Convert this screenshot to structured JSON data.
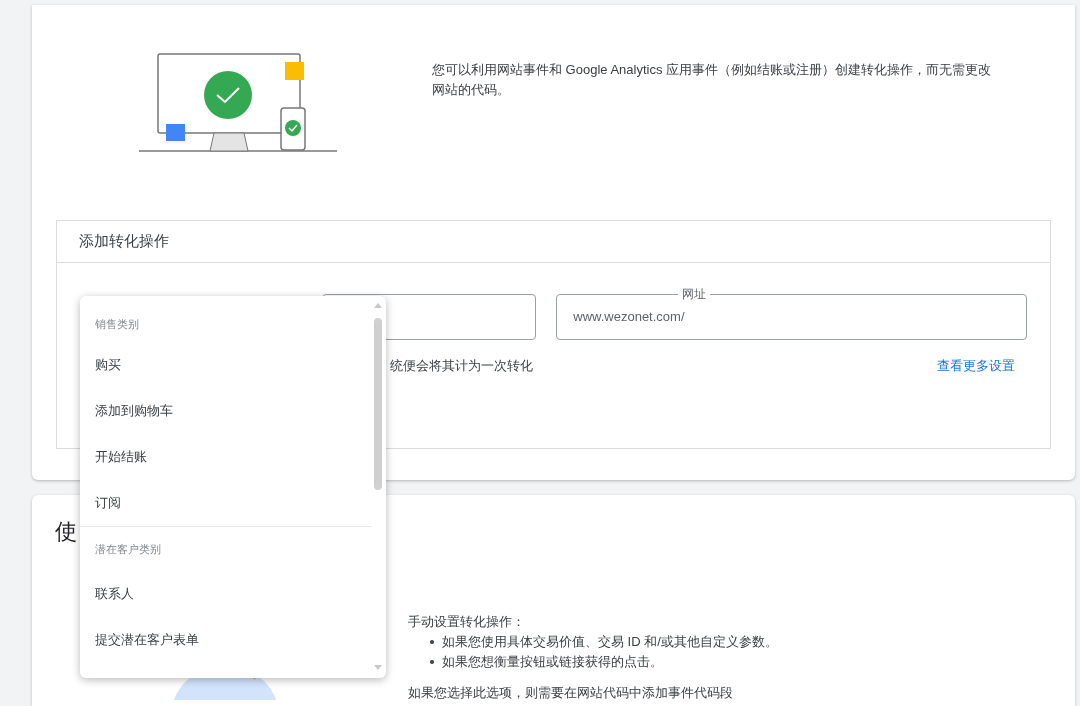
{
  "intro": {
    "text": "您可以利用网站事件和 Google Analytics 应用事件（例如结账或注册）创建转化操作，而无需更改网站的代码。"
  },
  "add_conversion": {
    "title": "添加转化操作",
    "fields": [
      {
        "focused": false
      },
      {
        "label": "网址",
        "value": "www.wezonet.com/",
        "focused": false
      }
    ],
    "hint": "统便会将其计为一次转化",
    "link": "查看更多设置"
  },
  "dropdown": {
    "groups": [
      {
        "heading": "销售类别",
        "items": [
          "购买",
          "添加到购物车",
          "开始结账",
          "订阅"
        ]
      },
      {
        "heading": "潜在客户类别",
        "items": [
          "联系人",
          "提交潜在客户表单"
        ]
      }
    ]
  },
  "section2": {
    "heading": "使",
    "intro": "手动设置转化操作：",
    "bullets": [
      "如果您使用具体交易价值、交易 ID 和/或其他自定义参数。",
      "如果您想衡量按钮或链接获得的点击。"
    ],
    "note": "如果您选择此选项，则需要在网站代码中添加事件代码段"
  }
}
